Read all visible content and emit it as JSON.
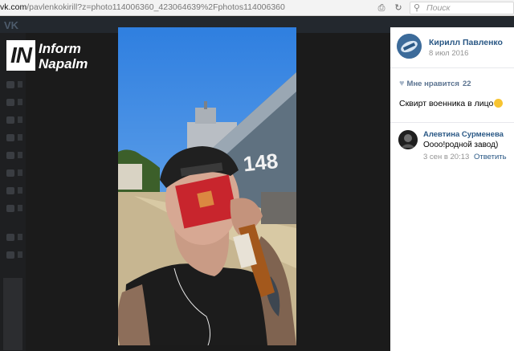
{
  "browser": {
    "url_host": "vk.com",
    "url_path": "/pavlenkokirill?z=photo114006360_423064639%2Fphotos114006360",
    "search_placeholder": "Поиск"
  },
  "vk": {
    "logo": "VK"
  },
  "watermark": {
    "box_text": "IN",
    "line1": "Inform",
    "line2": "Napalm"
  },
  "photo": {
    "ship_number": "148"
  },
  "post": {
    "author": "Кирилл Павленко",
    "date": "8 июл 2016",
    "likes_label": "Мне нравится",
    "likes_count": "22",
    "caption": "Сквирт военника в лицо"
  },
  "comment": {
    "author": "Алевтина Сурменева",
    "text": "Оооо!родной завод)",
    "time": "3 сен в 20:13",
    "reply_label": "Ответить"
  },
  "colors": {
    "link": "#2a5885",
    "muted": "#939393",
    "dim_bg": "#1b1b1b"
  }
}
